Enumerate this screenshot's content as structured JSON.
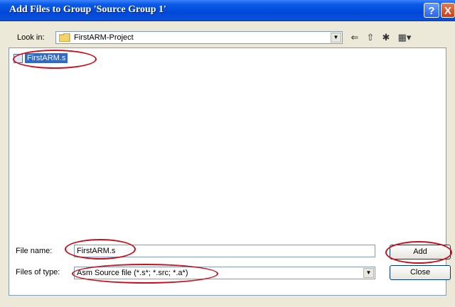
{
  "window": {
    "title": "Add Files to Group 'Source Group 1'",
    "help_glyph": "?",
    "close_glyph": "X"
  },
  "toolbar": {
    "look_in_label": "Look in:",
    "look_in_value": "FirstARM-Project",
    "dropdown_glyph": "▼",
    "back_glyph": "⇐",
    "up_glyph": "⇧",
    "new_folder_glyph": "✱",
    "views_glyph": "▦▾"
  },
  "file_list": {
    "items": [
      {
        "name": "FirstARM.s"
      }
    ]
  },
  "form": {
    "file_name_label": "File name:",
    "file_name_value": "FirstARM.s",
    "files_of_type_label": "Files of type:",
    "files_of_type_value": "Asm Source file (*.s*; *.src; *.a*)",
    "add_label": "Add",
    "close_label": "Close"
  },
  "colors": {
    "title_bar": "#0a52dc",
    "selection": "#316ac5",
    "annotation": "#c8101e",
    "dialog_bg": "#ece9d8"
  }
}
